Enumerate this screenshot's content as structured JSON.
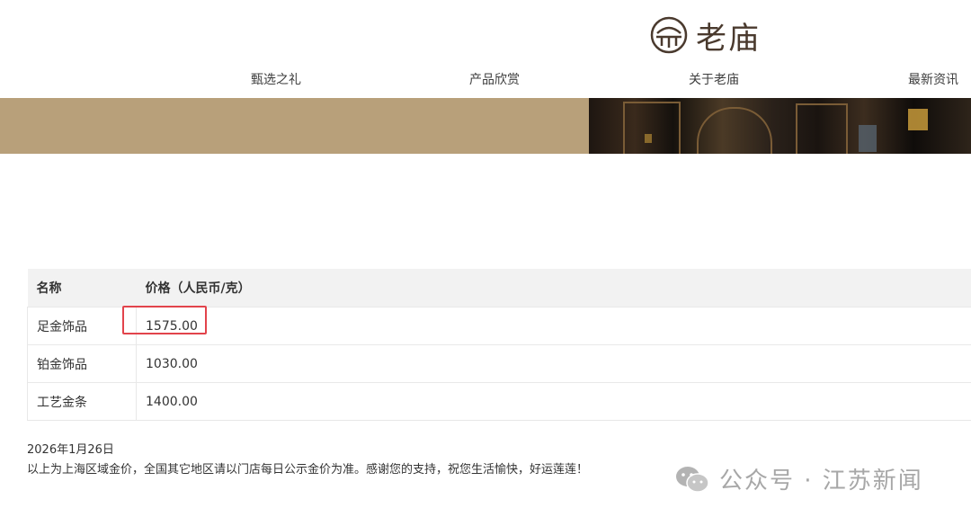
{
  "brand": {
    "name": "老庙",
    "logo_icon": "laomiao-logo-icon"
  },
  "nav": {
    "items": [
      {
        "label": "甄选之礼"
      },
      {
        "label": "产品欣赏"
      },
      {
        "label": "关于老庙"
      },
      {
        "label": "最新资讯"
      }
    ]
  },
  "banner": {
    "background": "#b8a07a"
  },
  "table": {
    "headers": [
      "名称",
      "价格（人民币/克）"
    ],
    "rows": [
      {
        "name": "足金饰品",
        "price": "1575.00"
      },
      {
        "name": "铂金饰品",
        "price": "1030.00"
      },
      {
        "name": "工艺金条",
        "price": "1400.00"
      }
    ],
    "highlight_color": "#e2434b"
  },
  "notes": {
    "date": "2026年1月26日",
    "text": "以上为上海区域金价，全国其它地区请以门店每日公示金价为准。感谢您的支持，祝您生活愉快，好运莲莲！"
  },
  "watermark": {
    "icon": "wechat-icon",
    "text": "公众号 · 江苏新闻"
  }
}
